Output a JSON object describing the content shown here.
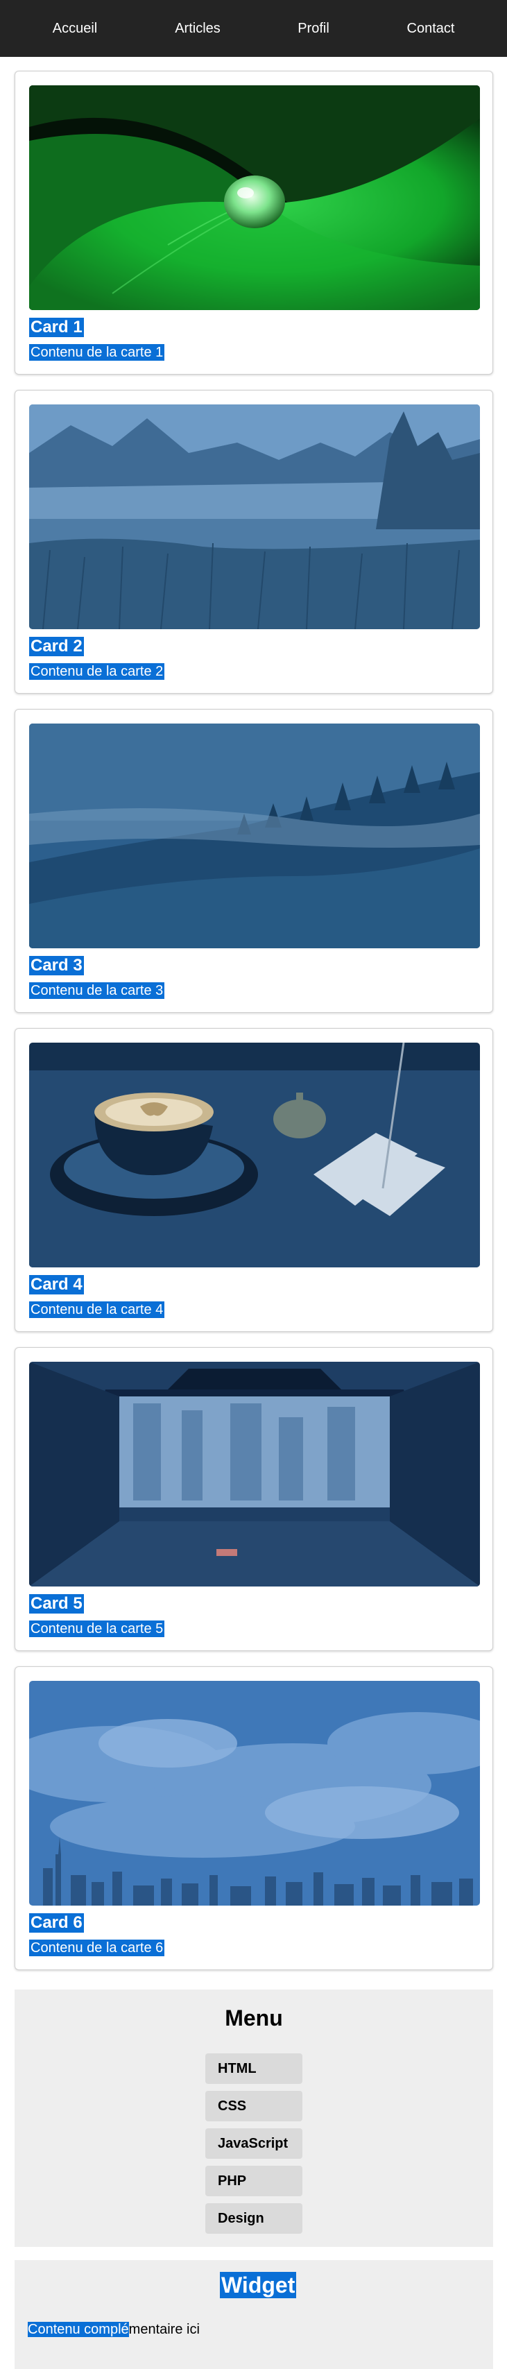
{
  "nav": {
    "items": [
      {
        "label": "Accueil"
      },
      {
        "label": "Articles"
      },
      {
        "label": "Profil"
      },
      {
        "label": "Contact"
      }
    ]
  },
  "cards": [
    {
      "title": "Card 1",
      "text": "Contenu de la carte 1",
      "image": "green-leaf-water-drop-photo"
    },
    {
      "title": "Card 2",
      "text": "Contenu de la carte 2",
      "image": "lake-mountains-grass-photo"
    },
    {
      "title": "Card 3",
      "text": "Contenu de la carte 3",
      "image": "misty-forest-hills-photo"
    },
    {
      "title": "Card 4",
      "text": "Contenu de la carte 4",
      "image": "coffee-cup-bell-receipts-photo"
    },
    {
      "title": "Card 5",
      "text": "Contenu de la carte 5",
      "image": "truck-interior-city-view-photo"
    },
    {
      "title": "Card 6",
      "text": "Contenu de la carte 6",
      "image": "city-skyline-clouds-photo"
    }
  ],
  "menu": {
    "title": "Menu",
    "items": [
      {
        "label": "HTML"
      },
      {
        "label": "CSS"
      },
      {
        "label": "JavaScript"
      },
      {
        "label": "PHP"
      },
      {
        "label": "Design"
      }
    ]
  },
  "widget": {
    "title": "Widget",
    "text_highlight": "Contenu complé",
    "text_rest": "mentaire ici"
  },
  "colors": {
    "nav_bg": "#242424",
    "highlight": "#0a6fd6",
    "panel_bg": "#eeeeee",
    "menu_item_bg": "#dadada"
  }
}
